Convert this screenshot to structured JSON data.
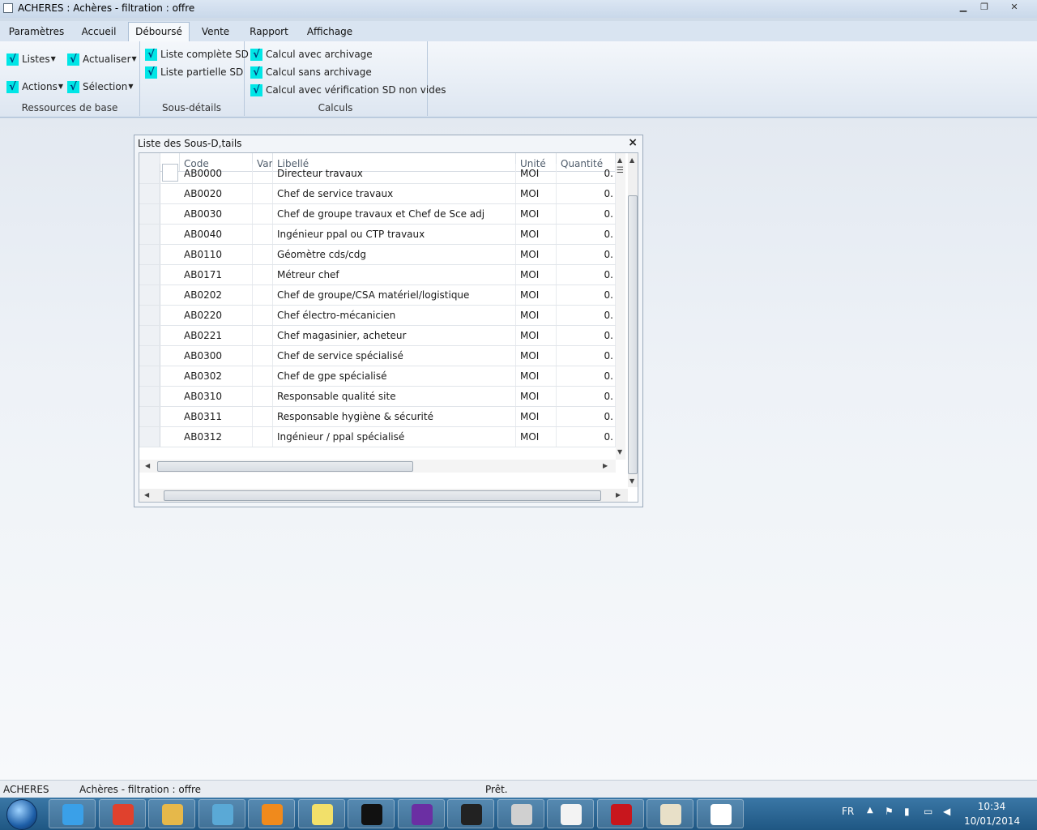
{
  "window": {
    "title": "ACHERES : Achères - filtration : offre"
  },
  "ribbon": {
    "tabs": [
      "Paramètres",
      "Accueil",
      "Déboursé",
      "Vente",
      "Rapport",
      "Affichage"
    ],
    "active_tab": "Déboursé",
    "groups": {
      "ressources": {
        "label": "Ressources de base",
        "items": [
          "Listes",
          "Actualiser",
          "Actions",
          "Sélection"
        ]
      },
      "sous_details": {
        "label": "Sous-détails",
        "items": [
          "Liste complète SD",
          "Liste partielle SD"
        ]
      },
      "calculs": {
        "label": "Calculs",
        "items": [
          "Calcul avec archivage",
          "Calcul sans archivage",
          "Calcul avec vérification SD non vides"
        ]
      }
    },
    "check_glyph": "√"
  },
  "child_window": {
    "title": "Liste des Sous-D,tails",
    "close": "×",
    "columns": [
      "Code",
      "Var",
      "Libellé",
      "Unité",
      "Quantité"
    ],
    "rows": [
      {
        "code": "AB0000",
        "libelle": "Directeur travaux",
        "unite": "MOI",
        "quantite": "0."
      },
      {
        "code": "AB0020",
        "libelle": "Chef de service travaux",
        "unite": "MOI",
        "quantite": "0."
      },
      {
        "code": "AB0030",
        "libelle": "Chef de groupe travaux et Chef de Sce adj",
        "unite": "MOI",
        "quantite": "0."
      },
      {
        "code": "AB0040",
        "libelle": "Ingénieur ppal ou CTP travaux",
        "unite": "MOI",
        "quantite": "0."
      },
      {
        "code": "AB0110",
        "libelle": "Géomètre cds/cdg",
        "unite": "MOI",
        "quantite": "0."
      },
      {
        "code": "AB0171",
        "libelle": "Métreur chef",
        "unite": "MOI",
        "quantite": "0."
      },
      {
        "code": "AB0202",
        "libelle": "Chef de groupe/CSA matériel/logistique",
        "unite": "MOI",
        "quantite": "0."
      },
      {
        "code": "AB0220",
        "libelle": "Chef électro-mécanicien",
        "unite": "MOI",
        "quantite": "0."
      },
      {
        "code": "AB0221",
        "libelle": "Chef magasinier, acheteur",
        "unite": "MOI",
        "quantite": "0."
      },
      {
        "code": "AB0300",
        "libelle": "Chef de service spécialisé",
        "unite": "MOI",
        "quantite": "0."
      },
      {
        "code": "AB0302",
        "libelle": "Chef de gpe spécialisé",
        "unite": "MOI",
        "quantite": "0."
      },
      {
        "code": "AB0310",
        "libelle": "Responsable qualité site",
        "unite": "MOI",
        "quantite": "0."
      },
      {
        "code": "AB0311",
        "libelle": "Responsable hygiène & sécurité",
        "unite": "MOI",
        "quantite": "0."
      },
      {
        "code": "AB0312",
        "libelle": "Ingénieur / ppal spécialisé",
        "unite": "MOI",
        "quantite": "0."
      }
    ]
  },
  "statusbar": {
    "db": "ACHERES",
    "context": "Achères - filtration : offre",
    "state": "Prêt."
  },
  "taskbar": {
    "apps": [
      "internet-explorer-icon",
      "chrome-icon",
      "explorer-icon",
      "network-icon",
      "outlook-icon",
      "sticky-notes-icon",
      "cmd-icon",
      "visual-studio-icon",
      "micro-edp-icon",
      "paint-tools-icon",
      "notepadpp-icon",
      "acrobat-icon",
      "paint-icon",
      "app-window-icon"
    ],
    "tray": {
      "lang": "FR",
      "time": "10:34",
      "date": "10/01/2014"
    }
  },
  "colors": {
    "accent_check": "#00e6e6",
    "ribbon_border": "#a9bdd5"
  }
}
